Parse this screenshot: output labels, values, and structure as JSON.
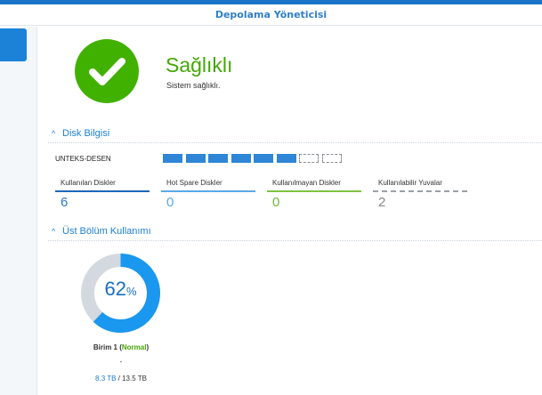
{
  "window": {
    "title": "Depolama Yöneticisi"
  },
  "health": {
    "status": "Sağlıklı",
    "message": "Sistem sağlıklı.",
    "color": "#41b100"
  },
  "disk_info": {
    "section_title": "Disk Bilgisi",
    "device_name": "UNTEKS-DESEN",
    "slots_used": 6,
    "slots_total": 8,
    "stats": [
      {
        "label": "Kullanılan Diskler",
        "value": "6",
        "color": "#1d66b8",
        "text_color": "#2a79c9"
      },
      {
        "label": "Hot Spare Diskler",
        "value": "0",
        "color": "#5aa9e6",
        "text_color": "#5aa9e6"
      },
      {
        "label": "Kullanılmayan Diskler",
        "value": "0",
        "color": "#7fc242",
        "text_color": "#6fb83a"
      },
      {
        "label": "Kullanılabilir Yuvalar",
        "value": "2",
        "color": "#9aa0a6",
        "text_color": "#888888"
      }
    ]
  },
  "volume_usage": {
    "section_title": "Üst Bölüm Kullanımı",
    "percent": "62",
    "percent_sign": "%",
    "usage_fraction": 0.62,
    "volume_name": "Birim 1",
    "volume_status": "Normal",
    "dash": "-",
    "used": "8.3 TB",
    "separator": " / ",
    "total": "13.5 TB",
    "used_color": "#1a97ee",
    "free_color": "#d3d9df"
  }
}
